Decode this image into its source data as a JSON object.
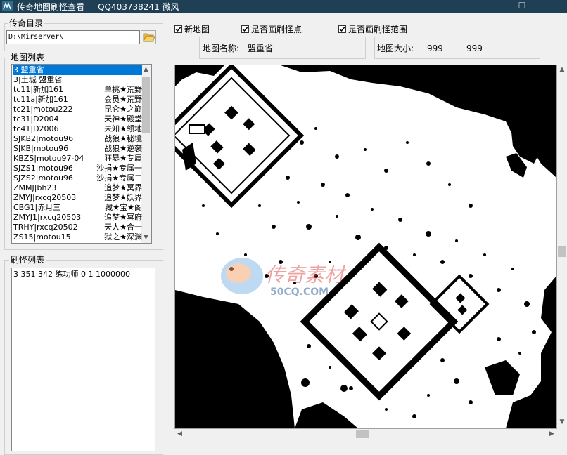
{
  "window": {
    "title": "传奇地图刷怪查看",
    "subtitle": "QQ403738241  微风",
    "minimize": "—",
    "maximize": "☐"
  },
  "dir_group": {
    "label": "传奇目录",
    "path": "D:\\Mirserver\\"
  },
  "map_list": {
    "label": "地图列表",
    "items": [
      {
        "code": "3 盟重省",
        "name": ""
      },
      {
        "code": "3|土城 盟重省",
        "name": ""
      },
      {
        "code": "tc11|新加161",
        "name": "单挑★荒野"
      },
      {
        "code": "tc11a|新加161",
        "name": "会员★荒野"
      },
      {
        "code": "tc21|motou222",
        "name": "昆仑★之巅"
      },
      {
        "code": "tc31|D2004",
        "name": "天神★殿堂"
      },
      {
        "code": "tc41|D2006",
        "name": "未知★领地"
      },
      {
        "code": "SJKB2|motou96",
        "name": "战狼★秘境"
      },
      {
        "code": "SJKB|motou96",
        "name": "战狼★逆袭"
      },
      {
        "code": "KBZS|motou97-04",
        "name": "狂暴★专属"
      },
      {
        "code": "SJZS1|motou96",
        "name": "沙捐★专属一"
      },
      {
        "code": "SJZS2|motou96",
        "name": "沙捐★专属二"
      },
      {
        "code": "ZMMJ|bh23",
        "name": "追梦★冥界"
      },
      {
        "code": "ZMYJ|rxcq20503",
        "name": "追梦★妖界"
      },
      {
        "code": "CBG1|赤月三",
        "name": "藏★宝★阁"
      },
      {
        "code": "ZMYJ1|rxcq20503",
        "name": "追梦★冥府"
      },
      {
        "code": "TRHY|rxcq20502",
        "name": "天人★合一"
      },
      {
        "code": "ZS15|motou15",
        "name": "狱之★深渊"
      }
    ]
  },
  "spawn_list": {
    "label": "刷怪列表",
    "items": [
      "3 351 342 练功师 0 1 1000000"
    ]
  },
  "options": {
    "new_map": "新地图",
    "draw_spawn_points": "是否画刷怪点",
    "draw_spawn_range": "是否画刷怪范围"
  },
  "map_info": {
    "name_label": "地图名称:",
    "name_value": "盟重省",
    "size_label": "地图大小:",
    "width": "999",
    "height": "999"
  },
  "watermark": {
    "text": "传奇素材",
    "sub": "50CQ.COM"
  }
}
